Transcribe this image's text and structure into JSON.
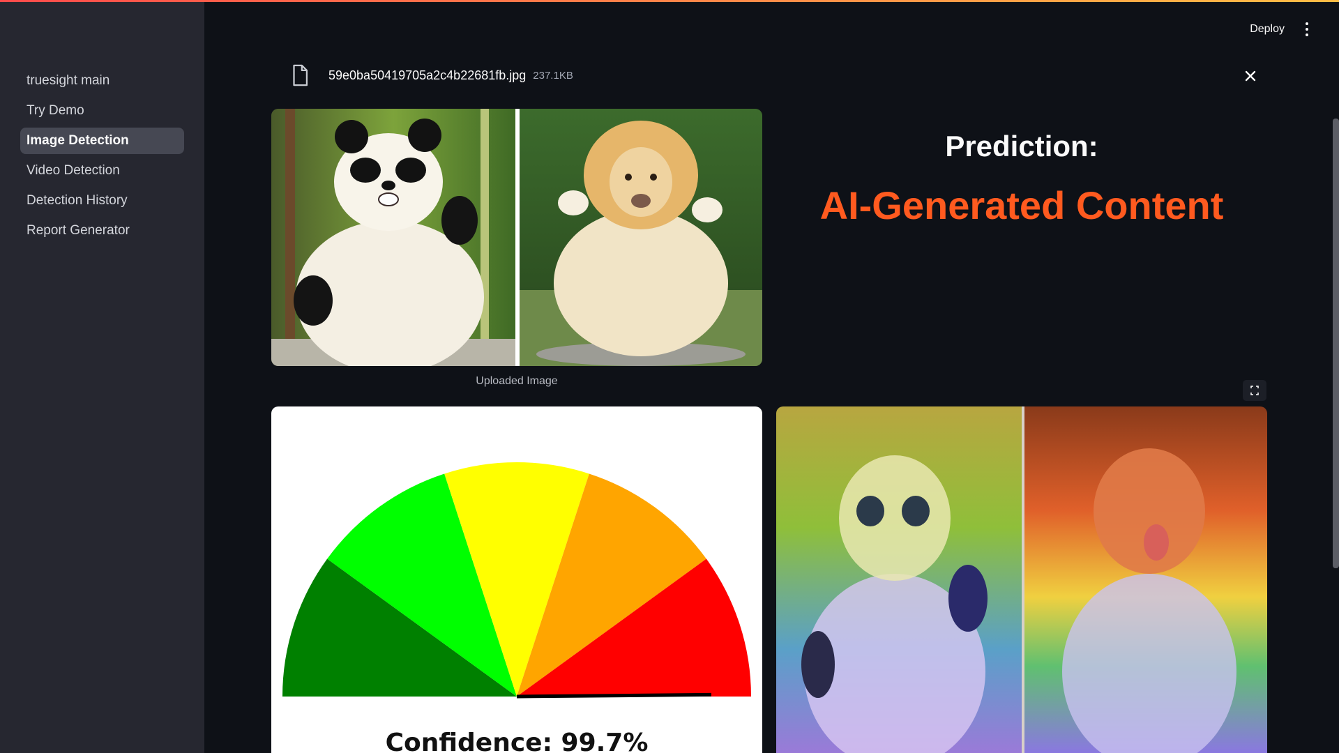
{
  "sidebar": {
    "items": [
      {
        "label": "truesight main",
        "active": false
      },
      {
        "label": "Try Demo",
        "active": false
      },
      {
        "label": "Image Detection",
        "active": true
      },
      {
        "label": "Video Detection",
        "active": false
      },
      {
        "label": "Detection History",
        "active": false
      },
      {
        "label": "Report Generator",
        "active": false
      }
    ]
  },
  "header": {
    "deploy_label": "Deploy",
    "menu_icon": "kebab-menu-icon"
  },
  "uploader": {
    "file_icon": "file-icon",
    "file_name": "59e0ba50419705a2c4b22681fb.jpg",
    "file_size": "237.1KB",
    "close_icon": "close-icon"
  },
  "upload_image": {
    "caption": "Uploaded Image",
    "content": "side-by-side photo of a chubby panda and a chubby lion"
  },
  "prediction": {
    "label": "Prediction:",
    "value": "AI-Generated Content",
    "value_color": "#ff5a1f"
  },
  "gauge": {
    "confidence_text": "Confidence: 99.7%",
    "confidence": 99.7,
    "segments": [
      "#008000",
      "#00ff00",
      "#ffff00",
      "#ffa500",
      "#ff0000"
    ]
  },
  "heatmap": {
    "fullscreen_icon": "fullscreen-icon",
    "content": "rainbow heatmap overlay on panda and lion image"
  },
  "colors": {
    "background": "#0e1117",
    "sidebar": "#262730",
    "accent": "#ff4b4b"
  }
}
